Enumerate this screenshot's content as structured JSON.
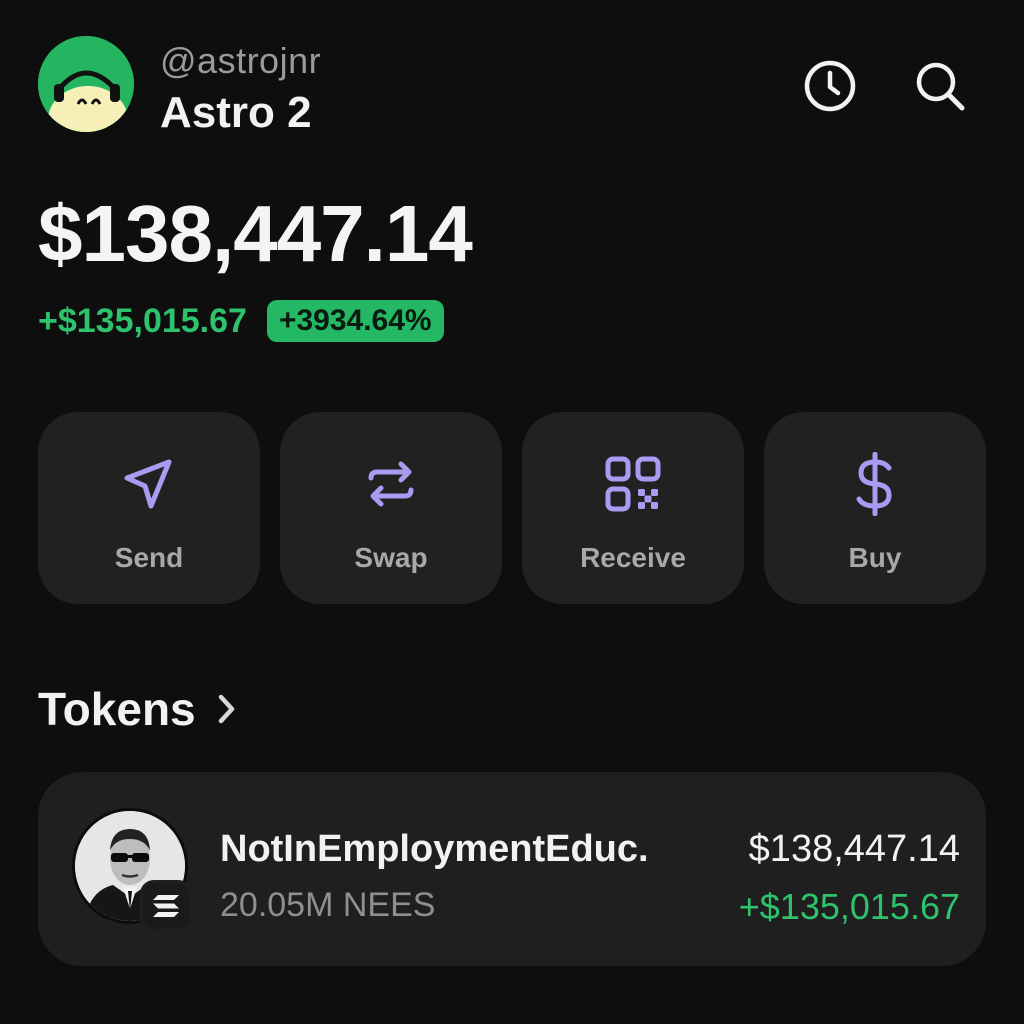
{
  "header": {
    "handle": "@astrojnr",
    "account_name": "Astro 2",
    "icons": [
      "history-icon",
      "search-icon"
    ]
  },
  "portfolio": {
    "balance": "$138,447.14",
    "change_amount": "+$135,015.67",
    "change_percent": "+3934.64%"
  },
  "actions": [
    {
      "label": "Send",
      "icon": "send-icon"
    },
    {
      "label": "Swap",
      "icon": "swap-icon"
    },
    {
      "label": "Receive",
      "icon": "qr-code-icon"
    },
    {
      "label": "Buy",
      "icon": "dollar-icon"
    }
  ],
  "tokens": {
    "title": "Tokens",
    "items": [
      {
        "name": "NotInEmploymentEduc.",
        "amount": "20.05M NEES",
        "value": "$138,447.14",
        "change": "+$135,015.67"
      }
    ]
  },
  "colors": {
    "background": "#0e0e0e",
    "card": "#212121",
    "positive": "#2dc26b",
    "accent_purple": "#a99bf2"
  }
}
